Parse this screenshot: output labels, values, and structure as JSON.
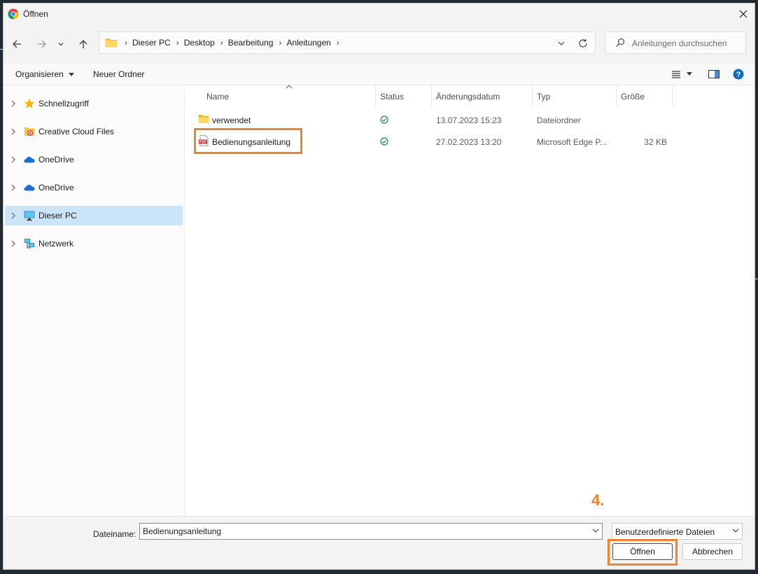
{
  "window": {
    "title": "Öffnen"
  },
  "breadcrumbs": [
    "Dieser PC",
    "Desktop",
    "Bearbeitung",
    "Anleitungen"
  ],
  "search": {
    "placeholder": "Anleitungen durchsuchen"
  },
  "commandbar": {
    "organize": "Organisieren",
    "new_folder": "Neuer Ordner"
  },
  "sidebar": {
    "items": [
      {
        "label": "Schnellzugriff",
        "icon": "star-icon"
      },
      {
        "label": "Creative Cloud Files",
        "icon": "creative-cloud-folder-icon"
      },
      {
        "label": "OneDrive",
        "icon": "onedrive-cloud-icon"
      },
      {
        "label": "OneDrive",
        "icon": "onedrive-cloud-icon"
      },
      {
        "label": "Dieser PC",
        "icon": "computer-icon",
        "selected": true
      },
      {
        "label": "Netzwerk",
        "icon": "network-icon"
      }
    ]
  },
  "columns": {
    "name": "Name",
    "status": "Status",
    "date": "Änderungsdatum",
    "type": "Typ",
    "size": "Größe"
  },
  "files": [
    {
      "name": "verwendet",
      "icon": "folder-icon",
      "status": "synced-check-icon",
      "date": "13.07.2023 15:23",
      "type": "Dateiordner",
      "size": ""
    },
    {
      "name": "Bedienungsanleitung",
      "icon": "pdf-icon",
      "status": "synced-check-icon",
      "date": "27.02.2023 13:20",
      "type": "Microsoft Edge P...",
      "size": "32 KB"
    }
  ],
  "footer": {
    "filename_label": "Dateiname:",
    "filename_value": "Bedienungsanleitung",
    "filetype": "Benutzerdefinierte Dateien",
    "open_label": "Öffnen",
    "cancel_label": "Abbrechen"
  },
  "annotation": {
    "step": "4."
  },
  "colors": {
    "highlight": "#f0822e",
    "selection": "#cce4f7",
    "sync_green": "#1f8a3a",
    "help_blue": "#0f6cbd"
  }
}
